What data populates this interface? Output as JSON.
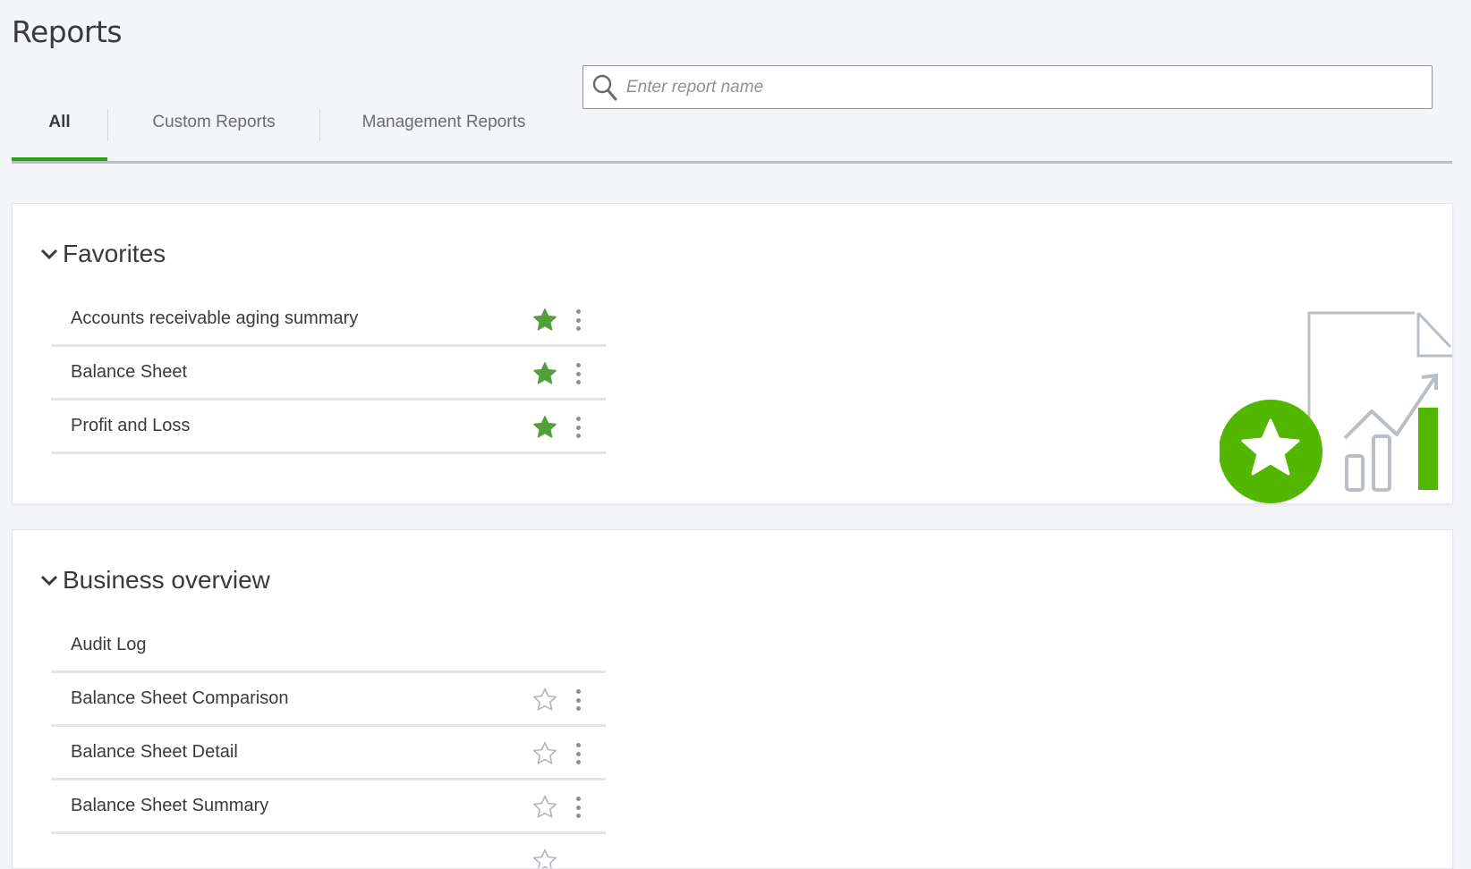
{
  "page": {
    "title": "Reports"
  },
  "tabs": [
    {
      "label": "All",
      "active": true
    },
    {
      "label": "Custom Reports",
      "active": false
    },
    {
      "label": "Management Reports",
      "active": false
    }
  ],
  "search": {
    "placeholder": "Enter report name",
    "value": "",
    "icon": "search-icon"
  },
  "colors": {
    "accent": "#2ca01c",
    "star_filled": "#53a03a",
    "star_outline": "#b3b6bc",
    "text": "#393a3d"
  },
  "favorites": {
    "title": "Favorites",
    "rows": [
      {
        "label": "Accounts receivable aging summary",
        "favorite": true
      },
      {
        "label": "Balance Sheet",
        "favorite": true
      },
      {
        "label": "Profit and Loss",
        "favorite": true
      }
    ]
  },
  "business_overview": {
    "title": "Business overview",
    "rows": [
      {
        "label": "Audit Log",
        "favorite": null
      },
      {
        "label": "Balance Sheet Comparison",
        "favorite": false
      },
      {
        "label": "Balance Sheet Detail",
        "favorite": false
      },
      {
        "label": "Balance Sheet Summary",
        "favorite": false
      }
    ]
  }
}
